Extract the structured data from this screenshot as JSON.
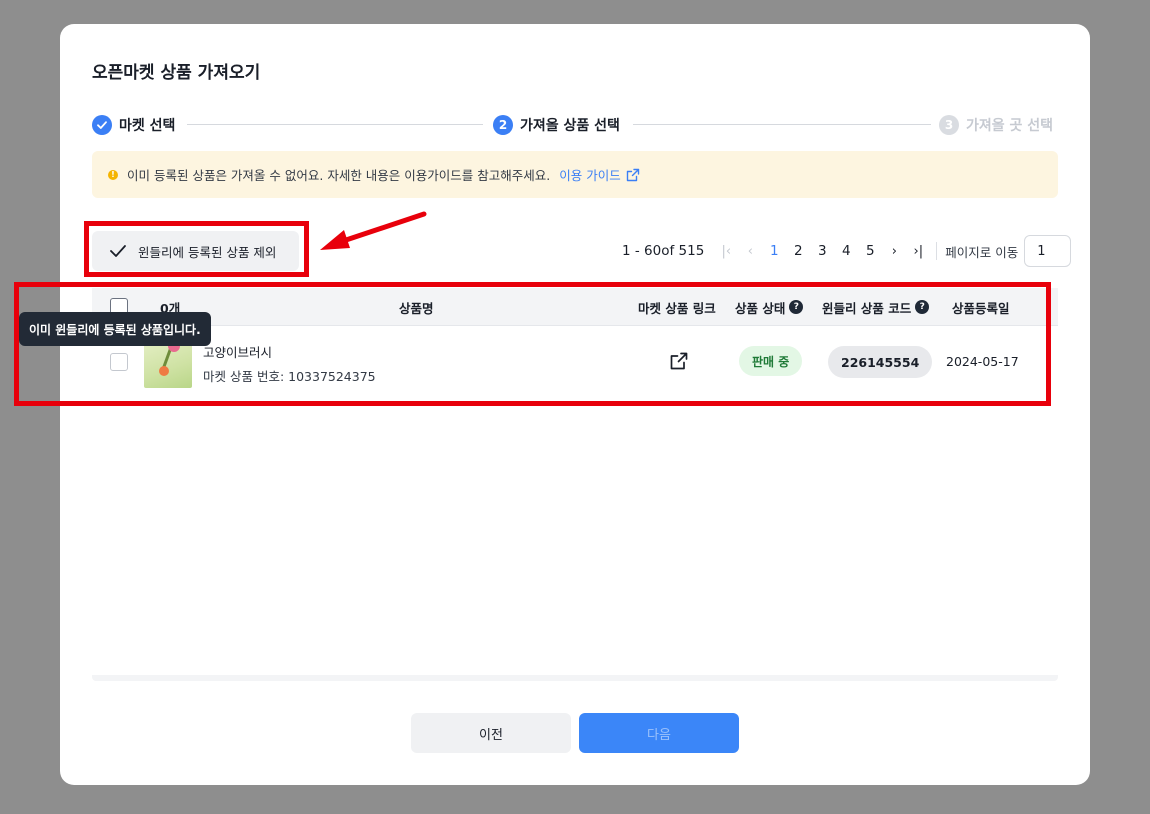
{
  "modal": {
    "title": "오픈마켓 상품 가져오기"
  },
  "stepper": {
    "steps": [
      {
        "index": "✓",
        "label": "마켓 선택",
        "state": "done"
      },
      {
        "index": "2",
        "label": "가져올 상품 선택",
        "state": "active"
      },
      {
        "index": "3",
        "label": "가져올 곳 선택",
        "state": "inactive"
      }
    ]
  },
  "notice": {
    "icon": "warning-icon",
    "text": "이미 등록된 상품은 가져올 수 없어요. 자세한 내용은 이용가이드를 참고해주세요.",
    "link_label": "이용 가이드",
    "link_icon": "external-link-icon"
  },
  "filter": {
    "exclude_label": "윈들리에 등록된 상품 제외",
    "checked": true
  },
  "pagination": {
    "range": "1 - 60of 515",
    "pages": [
      "1",
      "2",
      "3",
      "4",
      "5"
    ],
    "current_page": "1",
    "goto_label": "페이지로 이동",
    "goto_value": "1"
  },
  "table": {
    "columns": {
      "count": "0개",
      "name": "상품명",
      "link": "마켓 상품 링크",
      "status": "상품 상태",
      "code": "윈들리 상품 코드",
      "date": "상품등록일"
    },
    "rows": [
      {
        "name": "고양이브러시",
        "market_number": "마켓 상품 번호: 10337524375",
        "status": "판매 중",
        "code": "226145554",
        "date": "2024-05-17"
      }
    ]
  },
  "tooltip": {
    "text": "이미 윈들리에 등록된 상품입니다."
  },
  "footer": {
    "prev_label": "이전",
    "next_label": "다음"
  },
  "colors": {
    "accent": "#3b7ff5",
    "annotation": "#e8000b",
    "status_bg": "#e3f7e5",
    "notice_bg": "#fdf5e0"
  }
}
